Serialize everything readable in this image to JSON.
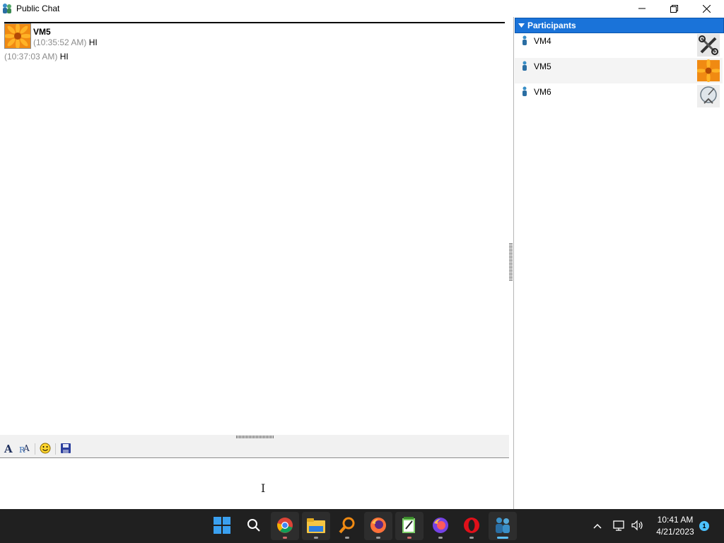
{
  "window": {
    "title": "Public Chat",
    "icon": "user-pair-icon",
    "controls": [
      "minimize-icon",
      "maximize-icon",
      "close-icon"
    ]
  },
  "chat": {
    "messages": [
      {
        "sender": "VM5",
        "timestamp": "(10:35:52 AM)",
        "text": "HI",
        "avatar": "orange-flower-avatar"
      },
      {
        "timestamp": "(10:37:03 AM)",
        "text": "HI"
      }
    ]
  },
  "toolbar": {
    "buttons": [
      "font-icon",
      "font-color-icon",
      "emoticon-icon",
      "save-icon"
    ]
  },
  "participants": {
    "header": "Participants",
    "items": [
      {
        "name": "VM4",
        "avatar": "tools-avatar"
      },
      {
        "name": "VM5",
        "avatar": "orange-flower-avatar"
      },
      {
        "name": "VM6",
        "avatar": "satellite-dish-avatar"
      }
    ]
  },
  "taskbar": {
    "apps": [
      "start-icon",
      "search-icon",
      "chrome-icon",
      "file-explorer-icon",
      "magnifier-search-icon",
      "firefox-icon",
      "notepad-icon",
      "firefox-developer-icon",
      "opera-icon",
      "chat-app-icon"
    ],
    "time": "10:41 AM",
    "date": "4/21/2023",
    "notification_count": "1"
  },
  "colors": {
    "participants_header": "#1a73d9",
    "timestamp_gray": "#8c8c8c",
    "taskbar": "#202020"
  }
}
